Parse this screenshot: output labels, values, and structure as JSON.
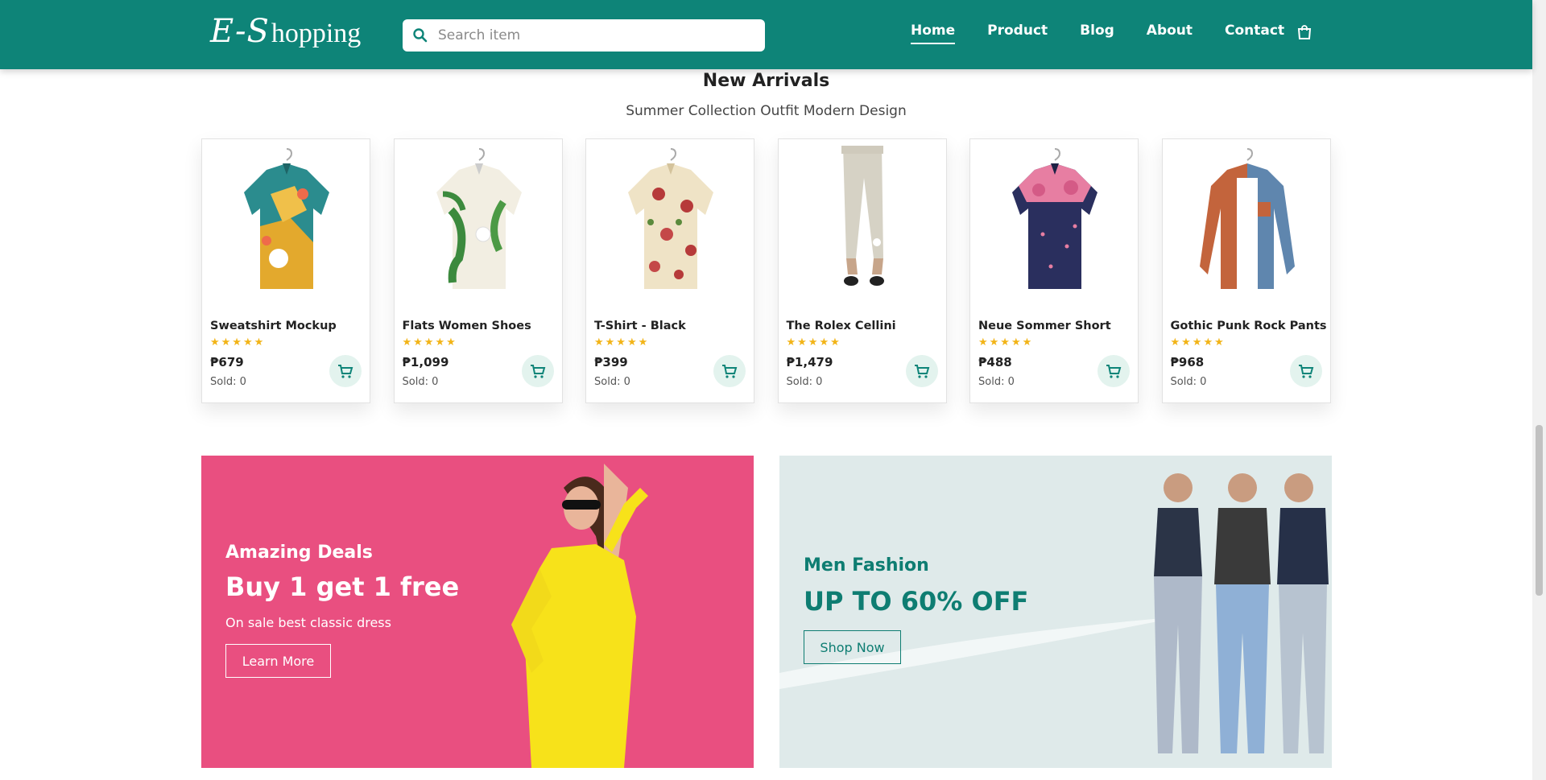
{
  "header": {
    "logo_script": "E-S",
    "logo_rest": "hopping",
    "search_placeholder": "Search item",
    "nav": [
      "Home",
      "Product",
      "Blog",
      "About",
      "Contact"
    ],
    "active_nav": "Home",
    "bg_color": "#0e8478",
    "cart_icon": "shopping-bag-icon"
  },
  "section": {
    "title": "New Arrivals",
    "subtitle": "Summer Collection Outfit Modern Design"
  },
  "products": [
    {
      "name": "Sweatshirt Mockup",
      "stars": "★★★★★",
      "price": "₱679",
      "sold": "Sold: 0",
      "image": "tropical-shirt"
    },
    {
      "name": "Flats Women Shoes",
      "stars": "★★★★★",
      "price": "₱1,099",
      "sold": "Sold: 0",
      "image": "floral-shirt"
    },
    {
      "name": "T-Shirt - Black",
      "stars": "★★★★★",
      "price": "₱399",
      "sold": "Sold: 0",
      "image": "rose-shirt"
    },
    {
      "name": "The Rolex Cellini",
      "stars": "★★★★★",
      "price": "₱1,479",
      "sold": "Sold: 0",
      "image": "linen-pants"
    },
    {
      "name": "Neue Sommer Short",
      "stars": "★★★★★",
      "price": "₱488",
      "sold": "Sold: 0",
      "image": "navy-floral-shirt"
    },
    {
      "name": "Gothic Punk Rock Pants",
      "stars": "★★★★★",
      "price": "₱968",
      "sold": "Sold: 0",
      "image": "corduroy-shirt"
    }
  ],
  "banners": {
    "left": {
      "subtitle": "Amazing Deals",
      "title": "Buy 1 get 1 free",
      "desc": "On sale best classic dress",
      "button": "Learn More",
      "bg": "#e94f80"
    },
    "right": {
      "subtitle": "Men Fashion",
      "title": "UP TO 60% OFF",
      "button": "Shop Now",
      "bg": "#dfeaea"
    }
  },
  "colors": {
    "accent": "#0e8478",
    "star": "#f2b418"
  }
}
